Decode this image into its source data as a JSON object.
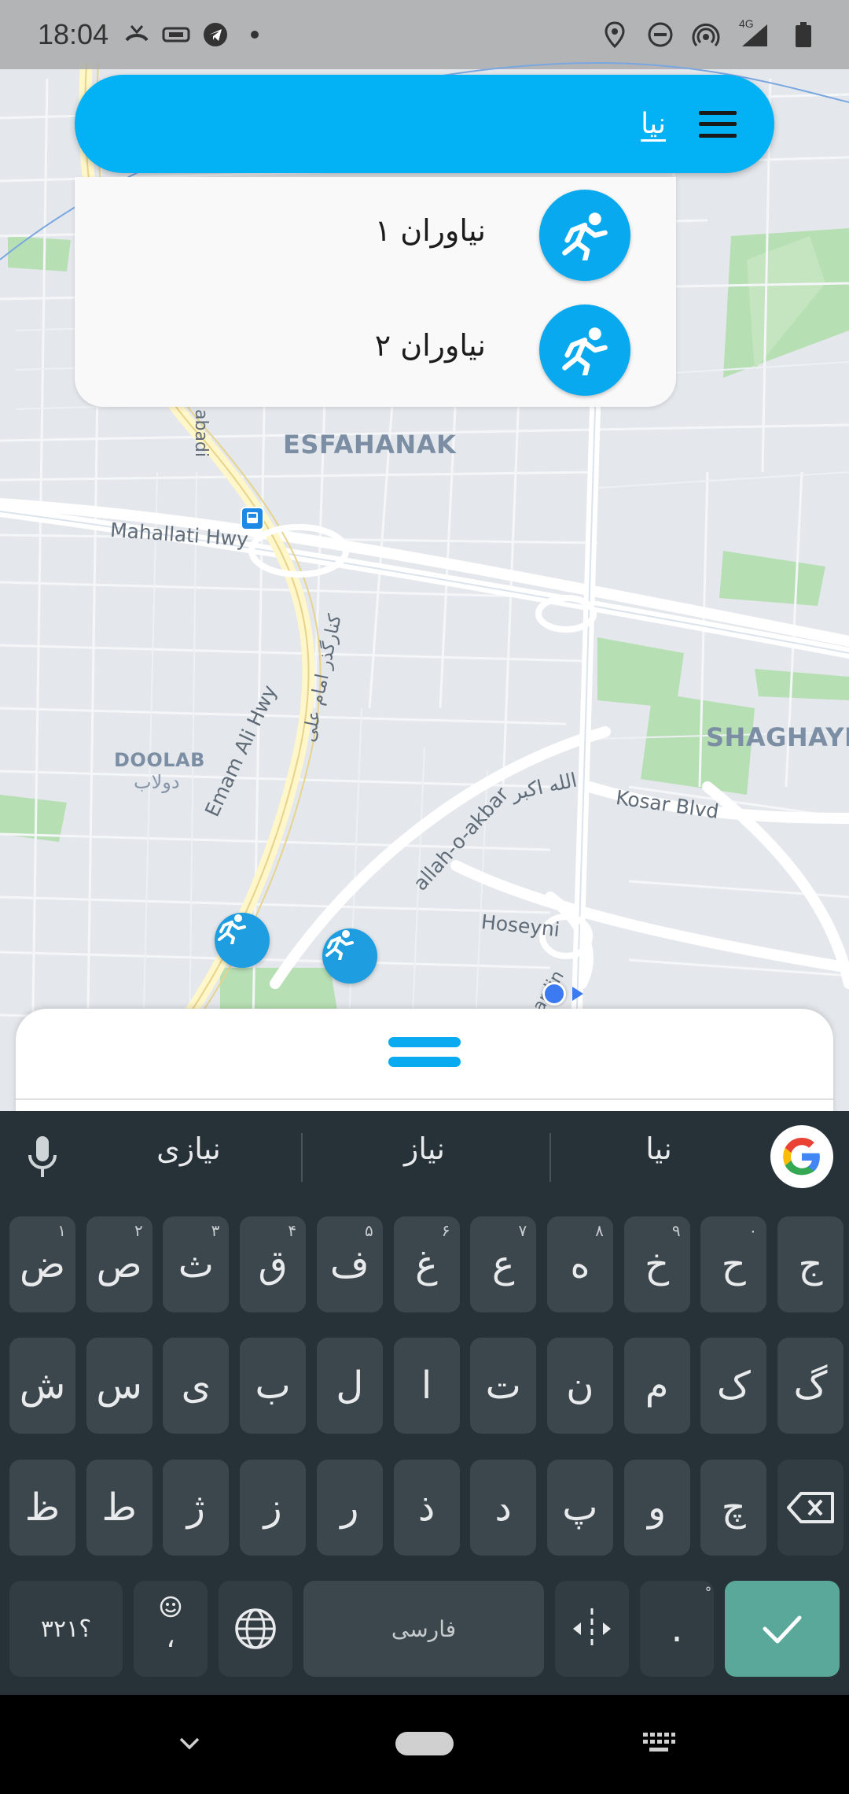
{
  "status_bar": {
    "time": "18:04",
    "network_label": "4G"
  },
  "search": {
    "query": "نیا"
  },
  "suggestions": [
    {
      "label": "نیاوران ۱",
      "icon": "runner-icon"
    },
    {
      "label": "نیاوران ۲",
      "icon": "runner-icon"
    }
  ],
  "map": {
    "labels": {
      "esfahanak": "ESFAHANAK",
      "mahallati": "Mahallati Hwy",
      "doolab": "DOOLAB",
      "doolab_fa": "دولاب",
      "shaghaye": "SHAGHAYE",
      "emam_ali": "Emam Ali Hwy",
      "emam_ali_fa": "کنارگذر امام علی",
      "kosar": "Kosar Blvd",
      "allah_akbar": "allah-o-akbar",
      "allah_akbar_fa": "الله اکبر",
      "hoseyni": "Hoseyni",
      "abadi": "abadi",
      "ardin": "ardin"
    }
  },
  "keyboard": {
    "suggestions": [
      "نیازی",
      "نیاز",
      "نیا"
    ],
    "row1": [
      {
        "k": "ض",
        "h": "۱"
      },
      {
        "k": "ص",
        "h": "۲"
      },
      {
        "k": "ث",
        "h": "۳"
      },
      {
        "k": "ق",
        "h": "۴"
      },
      {
        "k": "ف",
        "h": "۵"
      },
      {
        "k": "غ",
        "h": "۶"
      },
      {
        "k": "ع",
        "h": "۷"
      },
      {
        "k": "ه",
        "h": "۸"
      },
      {
        "k": "خ",
        "h": "۹"
      },
      {
        "k": "ح",
        "h": "۰"
      },
      {
        "k": "ج",
        "h": ""
      }
    ],
    "row2": [
      "ش",
      "س",
      "ی",
      "ب",
      "ل",
      "ا",
      "ت",
      "ن",
      "م",
      "ک",
      "گ"
    ],
    "row3": [
      "ظ",
      "ط",
      "ژ",
      "ز",
      "ر",
      "ذ",
      "د",
      "پ",
      "و",
      "چ"
    ],
    "symbols_key": "؟۳۲۱",
    "emoji_comma": "،",
    "space_label": "فارسی",
    "period_key": ".",
    "period_hint": "ْ"
  },
  "colors": {
    "accent": "#03b1f5",
    "keyboard_bg": "#263238",
    "key_bg": "#3c474d",
    "enter_key": "#5aa89a",
    "map_bg": "#e4e8ec",
    "park": "#b7dfb4"
  }
}
